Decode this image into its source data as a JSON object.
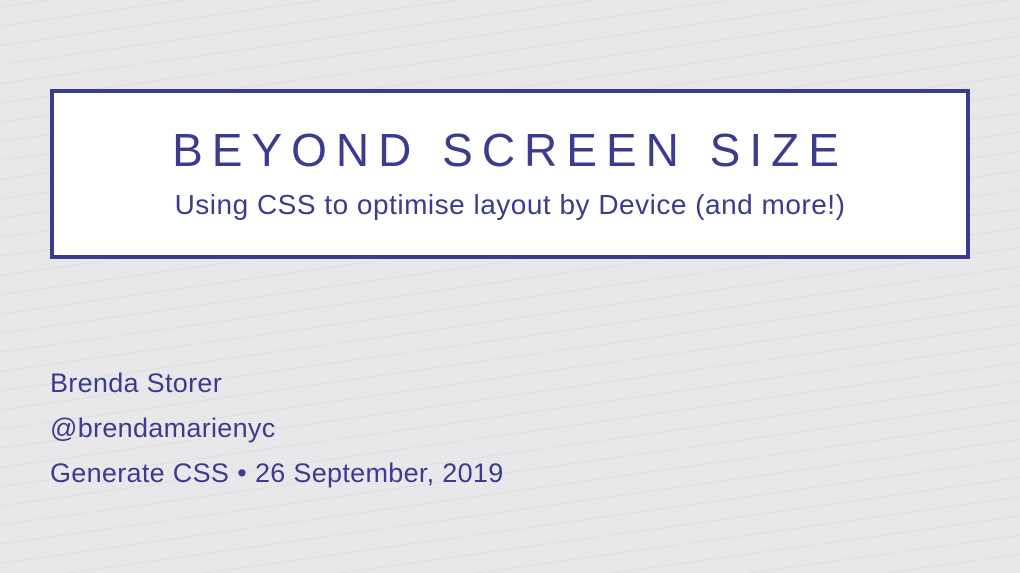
{
  "title": "BEYOND  SCREEN  SIZE",
  "subtitle": "Using CSS to optimise layout by Device (and more!)",
  "author": {
    "name": "Brenda Storer",
    "handle": "@brendamarienyc"
  },
  "event": {
    "name": "Generate CSS",
    "separator": "•",
    "date": "26 September, 2019"
  }
}
